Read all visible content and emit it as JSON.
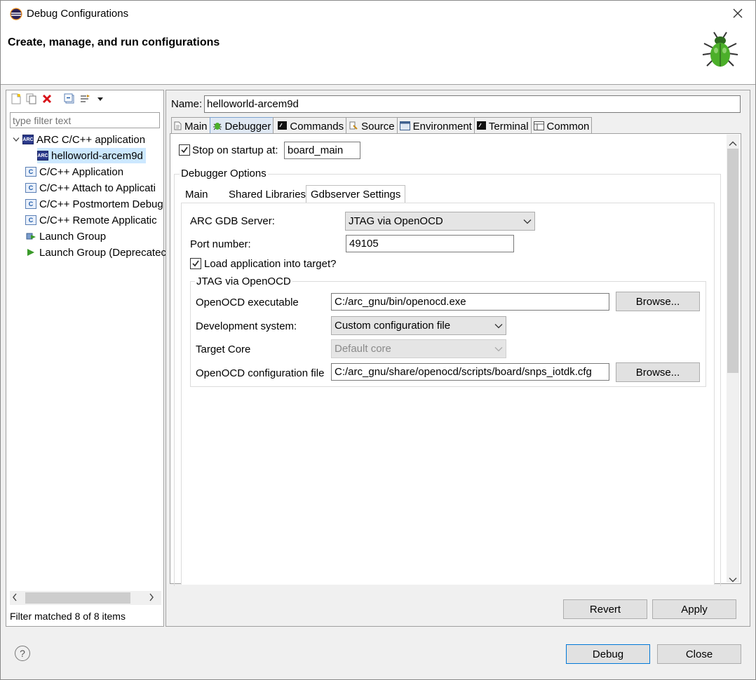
{
  "window": {
    "title": "Debug Configurations",
    "header": "Create, manage, and run configurations"
  },
  "left": {
    "filter_placeholder": "type filter text",
    "tree": [
      {
        "label": "ARC C/C++ application",
        "icon": "arc-icon"
      },
      {
        "label": "helloworld-arcem9d",
        "icon": "arc-icon"
      },
      {
        "label": "C/C++ Application",
        "icon": "c-icon"
      },
      {
        "label": "C/C++ Attach to Applicati",
        "icon": "c-icon"
      },
      {
        "label": "C/C++ Postmortem Debug",
        "icon": "c-icon"
      },
      {
        "label": "C/C++ Remote Applicatic",
        "icon": "c-icon"
      },
      {
        "label": "Launch Group",
        "icon": "launch-group-icon"
      },
      {
        "label": "Launch Group (Deprecatec",
        "icon": "launch-group-deprecated-icon"
      }
    ],
    "status": "Filter matched 8 of 8 items"
  },
  "right": {
    "name_label": "Name:",
    "name_value": "helloworld-arcem9d",
    "tabs": [
      "Main",
      "Debugger",
      "Commands",
      "Source",
      "Environment",
      "Terminal",
      "Common"
    ],
    "stop_on_startup_label": "Stop on startup at:",
    "stop_on_startup_value": "board_main",
    "debugger_options_label": "Debugger Options",
    "subtabs": [
      "Main",
      "Shared Libraries",
      "Gdbserver Settings"
    ],
    "arc_gdb_server_label": "ARC GDB Server:",
    "arc_gdb_server_value": "JTAG via OpenOCD",
    "port_label": "Port number:",
    "port_value": "49105",
    "load_app_label": "Load application into target?",
    "jtag_group_label": "JTAG via OpenOCD",
    "openocd_exe_label": "OpenOCD executable",
    "openocd_exe_value": "C:/arc_gnu/bin/openocd.exe",
    "browse_label": "Browse...",
    "dev_system_label": "Development system:",
    "dev_system_value": "Custom configuration file",
    "target_core_label": "Target Core",
    "target_core_value": "Default core",
    "openocd_cfg_label": "OpenOCD configuration file",
    "openocd_cfg_value": "C:/arc_gnu/share/openocd/scripts/board/snps_iotdk.cfg",
    "revert_label": "Revert",
    "apply_label": "Apply"
  },
  "footer": {
    "help_label": "?",
    "debug_label": "Debug",
    "close_label": "Close"
  }
}
